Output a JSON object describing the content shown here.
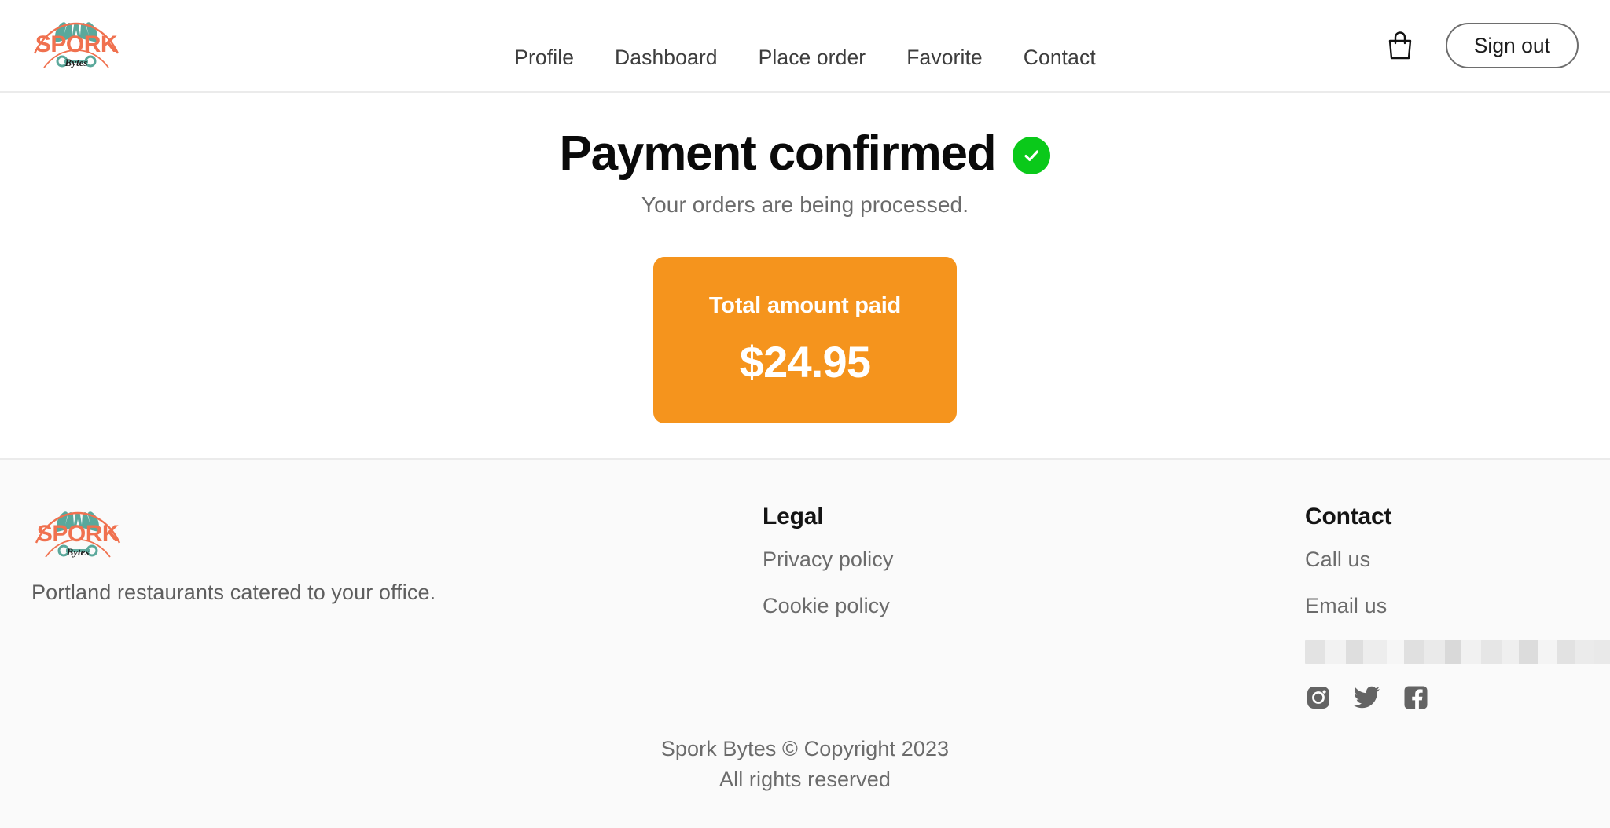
{
  "header": {
    "logo": {
      "name": "spork-bytes-logo",
      "wordmark": "SPORK",
      "script": "Bytes",
      "colors": {
        "orange": "#f0714f",
        "teal": "#5aa89b",
        "dark": "#1c1c1c"
      }
    },
    "nav": [
      {
        "label": "Profile",
        "name": "nav-link-profile"
      },
      {
        "label": "Dashboard",
        "name": "nav-link-dashboard"
      },
      {
        "label": "Place order",
        "name": "nav-link-place-order"
      },
      {
        "label": "Favorite",
        "name": "nav-link-favorite"
      },
      {
        "label": "Contact",
        "name": "nav-link-contact"
      }
    ],
    "cart_icon": "shopping-bag-icon",
    "signout_label": "Sign out"
  },
  "main": {
    "heading": "Payment confirmed",
    "status_icon": "green-check-circle-icon",
    "subheading": "Your orders are being processed.",
    "amount_card": {
      "label": "Total amount paid",
      "value": "$24.95"
    }
  },
  "footer": {
    "tagline": "Portland restaurants catered to your office.",
    "legal": {
      "heading": "Legal",
      "links": [
        {
          "label": "Privacy policy",
          "name": "footer-link-privacy-policy"
        },
        {
          "label": "Cookie policy",
          "name": "footer-link-cookie-policy"
        }
      ]
    },
    "contact": {
      "heading": "Contact",
      "links": [
        {
          "label": "Call us",
          "name": "footer-link-call-us"
        },
        {
          "label": "Email us",
          "name": "footer-link-email-us"
        }
      ],
      "redacted_text": ""
    },
    "social": [
      {
        "name": "instagram-icon",
        "label": "Instagram"
      },
      {
        "name": "twitter-icon",
        "label": "Twitter"
      },
      {
        "name": "facebook-icon",
        "label": "Facebook"
      }
    ],
    "copyright_line_1": "Spork Bytes © Copyright 2023",
    "copyright_line_2": "All rights reserved"
  },
  "colors": {
    "brand_orange": "#f5941d",
    "logo_orange": "#f0714f",
    "logo_teal": "#5aa89b",
    "success_green": "#0ac91a",
    "footer_bg": "#fafafa",
    "border": "#ebebeb",
    "body_text": "#6b6b6b"
  }
}
